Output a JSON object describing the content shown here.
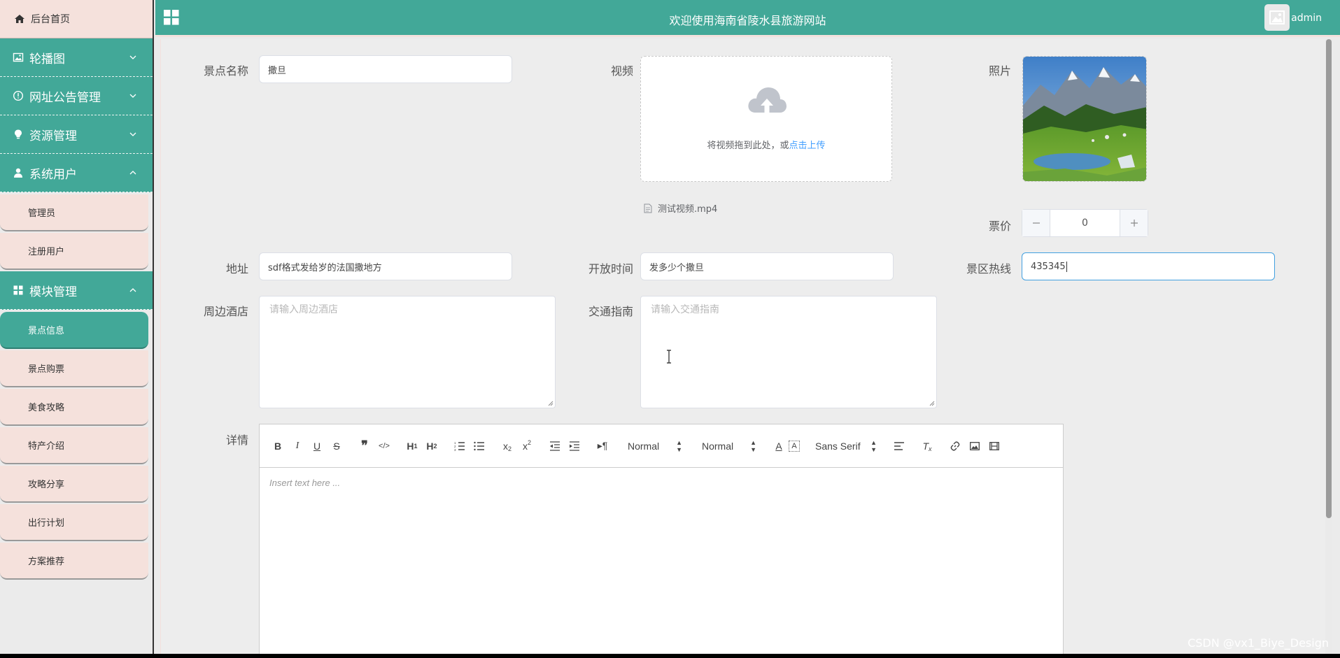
{
  "sidebar": {
    "home": "后台首页",
    "groups": [
      {
        "label": "轮播图",
        "expanded": false
      },
      {
        "label": "网址公告管理",
        "expanded": false
      },
      {
        "label": "资源管理",
        "expanded": false
      },
      {
        "label": "系统用户",
        "expanded": true
      },
      {
        "label": "模块管理",
        "expanded": true
      }
    ],
    "user_items": [
      "管理员",
      "注册用户"
    ],
    "module_items": [
      "景点信息",
      "景点购票",
      "美食攻略",
      "特产介绍",
      "攻略分享",
      "出行计划",
      "方案推荐"
    ],
    "active_item": "景点信息"
  },
  "header": {
    "title": "欢迎使用海南省陵水县旅游网站",
    "username": "admin"
  },
  "form": {
    "name_label": "景点名称",
    "name_value": "撒旦",
    "video_label": "视频",
    "upload_text": "将视频拖到此处，或",
    "upload_link": "点击上传",
    "video_file": "测试视频.mp4",
    "photo_label": "照片",
    "price_label": "票价",
    "price_value": "0",
    "address_label": "地址",
    "address_value": "sdf格式发给岁的法国撒地方",
    "open_time_label": "开放时间",
    "open_time_value": "发多少个撒旦",
    "hotline_label": "景区热线",
    "hotline_value": "435345",
    "hotel_label": "周边酒店",
    "hotel_placeholder": "请输入周边酒店",
    "traffic_label": "交通指南",
    "traffic_placeholder": "请输入交通指南",
    "detail_label": "详情"
  },
  "editor": {
    "header_select": "Normal",
    "size_select": "Normal",
    "font_select": "Sans Serif",
    "placeholder": "Insert text here ..."
  },
  "watermark": "CSDN @vx1_Biye_Design",
  "colors": {
    "primary": "#42a898",
    "submenu_bg": "#f5e1dc",
    "link": "#409eff"
  }
}
